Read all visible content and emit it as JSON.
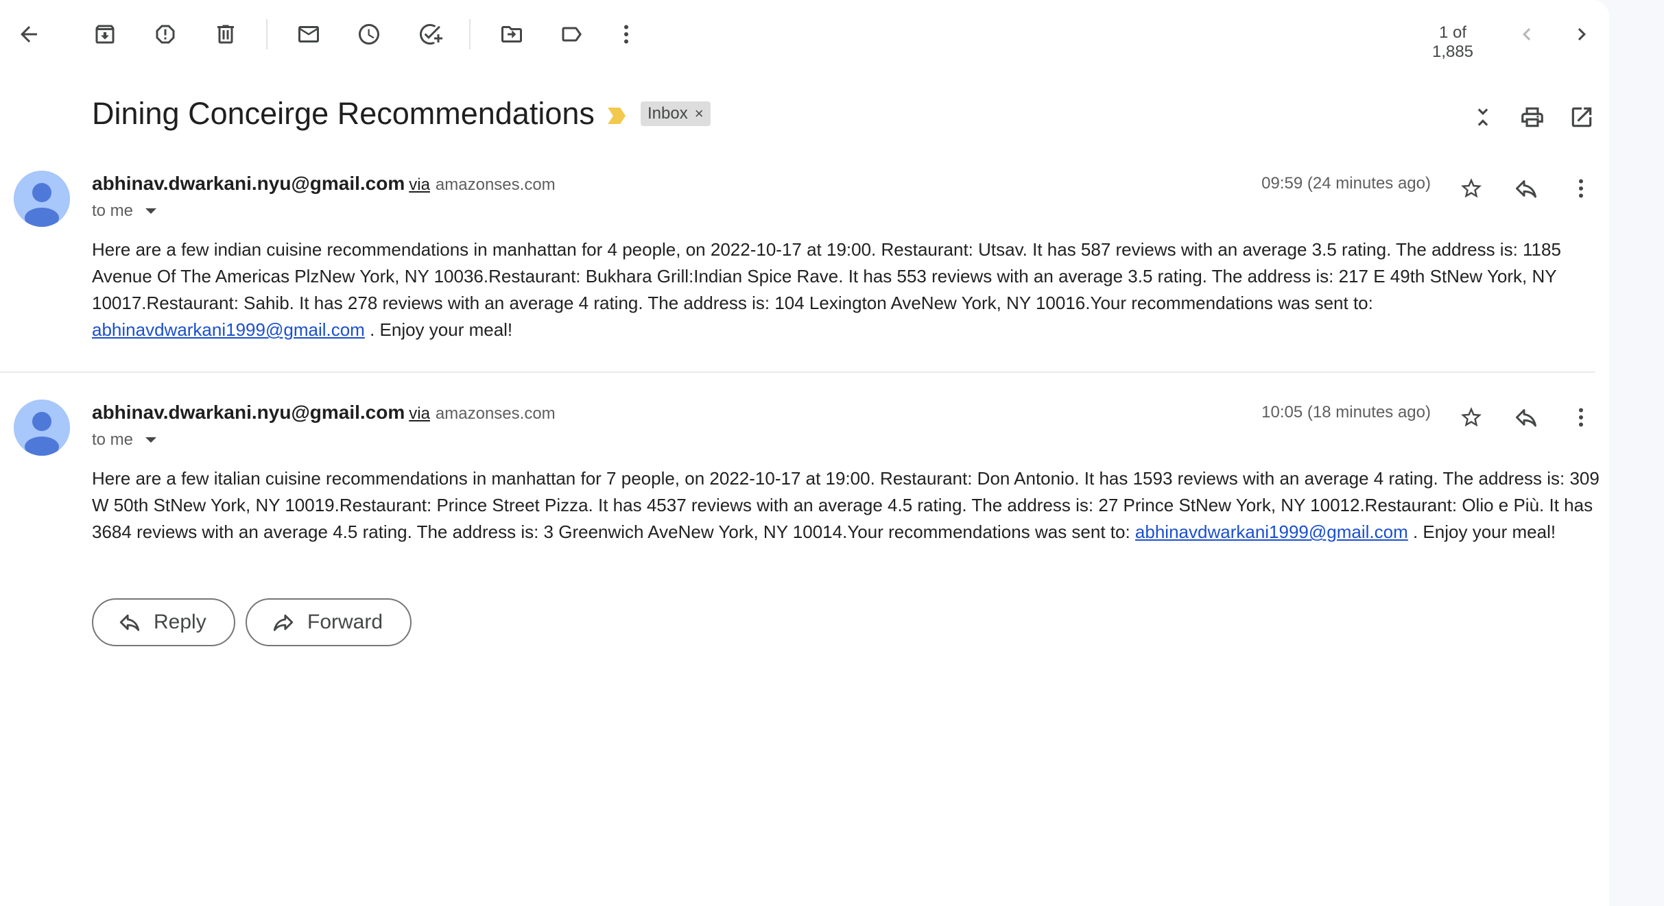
{
  "toolbar": {
    "back_icon": "arrow-left-icon",
    "actions": [
      "archive-icon",
      "report-spam-icon",
      "delete-icon",
      "mark-unread-icon",
      "snooze-icon",
      "add-task-icon",
      "move-to-icon",
      "label-icon",
      "more-vert-icon"
    ],
    "pager": "1 of 1,885"
  },
  "thread": {
    "subject": "Dining Conceirge Recommendations",
    "label": "Inbox",
    "label_remove": "×"
  },
  "messages": [
    {
      "sender": "abhinav.dwarkani.nyu@gmail.com",
      "via": "via",
      "domain": "amazonses.com",
      "to": "to me",
      "time": "09:59 (24 minutes ago)",
      "body_text": "Here are a few indian cuisine recommendations in manhattan for 4 people, on 2022-10-17 at 19:00. Restaurant: Utsav. It has 587 reviews with an average 3.5 rating. The address is: 1185 Avenue Of The Americas PlzNew York, NY 10036.Restaurant: Bukhara Grill:Indian Spice Rave. It has 553 reviews with an average 3.5 rating. The address is: 217 E 49th StNew York, NY 10017.Restaurant: Sahib. It has 278 reviews with an average 4 rating. The address is: 104 Lexington AveNew York, NY 10016.Your recommendations was sent to:",
      "link": "abhinavdwarkani1999@gmail.com",
      "closing": " . Enjoy your meal!"
    },
    {
      "sender": "abhinav.dwarkani.nyu@gmail.com",
      "via": "via",
      "domain": "amazonses.com",
      "to": "to me",
      "time": "10:05 (18 minutes ago)",
      "body_text": "Here are a few italian cuisine recommendations in manhattan for 7 people, on 2022-10-17 at 19:00. Restaurant: Don Antonio. It has 1593 reviews with an average 4 rating. The address is: 309 W 50th StNew York, NY 10019.Restaurant: Prince Street Pizza. It has 4537 reviews with an average 4.5 rating. The address is: 27 Prince StNew York, NY 10012.Restaurant: Olio e Più. It has 3684 reviews with an average 4.5 rating. The address is: 3 Greenwich AveNew York, NY 10014.Your recommendations was sent to:",
      "link": "abhinavdwarkani1999@gmail.com",
      "closing": " . Enjoy your meal!"
    }
  ],
  "actions": {
    "reply": "Reply",
    "forward": "Forward"
  }
}
